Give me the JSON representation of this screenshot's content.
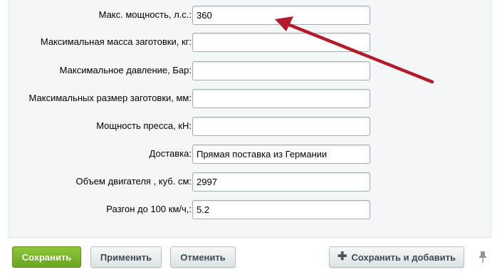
{
  "form": {
    "fields": [
      {
        "label": "Макс. мощность, л.с.:",
        "value": "360"
      },
      {
        "label": "Максимальная масса заготовки, кг:",
        "value": ""
      },
      {
        "label": "Максимальное давление, Бар:",
        "value": ""
      },
      {
        "label": "Максимальных размер заготовки, мм:",
        "value": ""
      },
      {
        "label": "Мощность пресса, кН:",
        "value": ""
      },
      {
        "label": "Доставка:",
        "value": "Прямая поставка из Германии"
      },
      {
        "label": "Объем двигателя , куб. см:",
        "value": "2997"
      },
      {
        "label": "Разгон до 100 км/ч,:",
        "value": "5.2"
      }
    ]
  },
  "footer": {
    "save_label": "Сохранить",
    "apply_label": "Применить",
    "cancel_label": "Отменить",
    "save_add_label": "Сохранить и добавить",
    "plus_icon": "plus-icon",
    "pin_icon": "pin-icon"
  },
  "colors": {
    "save_button": "#7ab62c",
    "panel_background": "#f4f7f8",
    "annotation_arrow": "#b31b2b"
  }
}
